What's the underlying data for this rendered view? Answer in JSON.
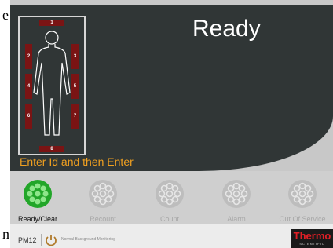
{
  "fragments": {
    "top": "e",
    "bottom": "n"
  },
  "screen": {
    "status": "Ready",
    "prompt": "Enter Id and then Enter"
  },
  "detectors": [
    "1",
    "2",
    "3",
    "4",
    "5",
    "6",
    "7",
    "8"
  ],
  "states": [
    {
      "label": "Ready/Clear",
      "active": true
    },
    {
      "label": "Recount",
      "active": false
    },
    {
      "label": "Count",
      "active": false
    },
    {
      "label": "Alarm",
      "active": false
    },
    {
      "label": "Out Of Service",
      "active": false
    }
  ],
  "footer": {
    "device_id": "PM12",
    "monitor_status": "Normal Background Monitoring"
  },
  "brand": {
    "name": "Thermo",
    "sub": "SCIENTIFIC"
  },
  "colors": {
    "screen_bg": "#303636",
    "prompt": "#f0a020",
    "lamp_active": "#22a629",
    "detector": "#7a1414"
  },
  "icons": {
    "power": "power-icon",
    "body": "body-outline-icon"
  }
}
